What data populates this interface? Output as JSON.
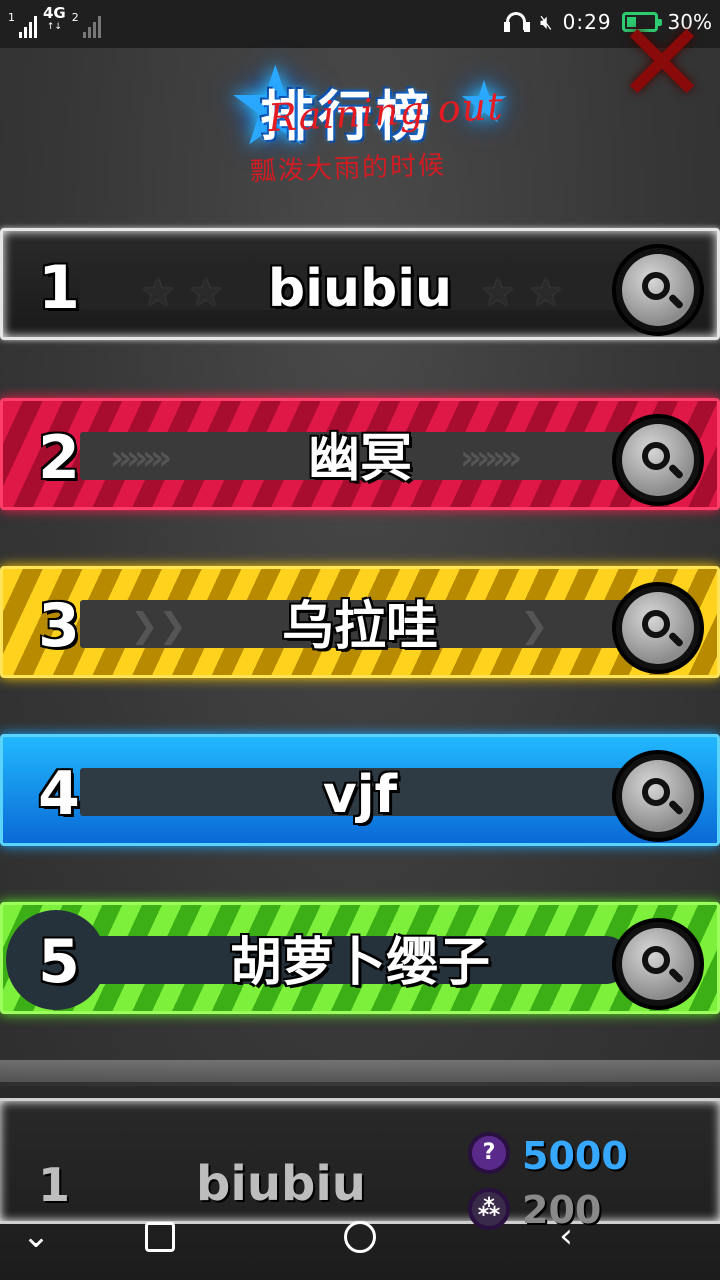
{
  "status_bar": {
    "sim1_label": "1",
    "network": "4G",
    "sim2_label": "2",
    "time": "0:29",
    "battery": "30%",
    "battery_level": 0.3
  },
  "title": {
    "main": "排行榜",
    "watermark_top": "Raining out",
    "watermark_bottom": "瓢泼大雨的时候"
  },
  "leaderboard": [
    {
      "rank": "1",
      "name": "biubiu",
      "theme_color": "#e6e6e6"
    },
    {
      "rank": "2",
      "name": "幽冥",
      "theme_color": "#e01848"
    },
    {
      "rank": "3",
      "name": "乌拉哇",
      "theme_color": "#ffd21e"
    },
    {
      "rank": "4",
      "name": "vjf",
      "theme_color": "#22b8ff"
    },
    {
      "rank": "5",
      "name": "胡萝卜缨子",
      "theme_color": "#7cf03a"
    }
  ],
  "self_entry": {
    "rank": "1",
    "name": "biubiu",
    "currency_primary": "5000",
    "currency_secondary": "200"
  },
  "icons": {
    "close": "close-x-icon",
    "search": "magnifier-icon"
  }
}
